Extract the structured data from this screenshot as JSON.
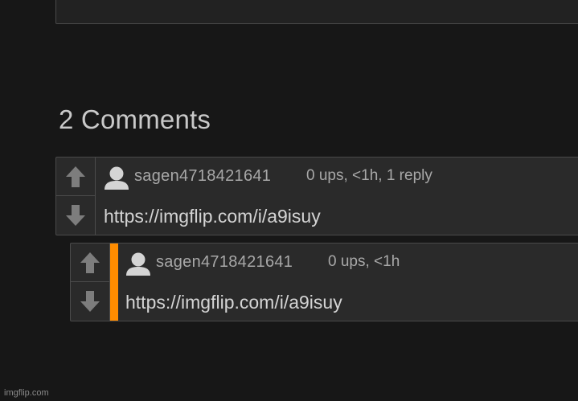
{
  "heading": "2 Comments",
  "comments": [
    {
      "username": "sagen4718421641",
      "meta": "0 ups, <1h, 1 reply",
      "text": "https://imgflip.com/i/a9isuy"
    },
    {
      "username": "sagen4718421641",
      "meta": "0 ups, <1h",
      "text": "https://imgflip.com/i/a9isuy"
    }
  ],
  "colors": {
    "background": "#171717",
    "panel": "#2a2a2a",
    "reply_accent": "#ff8c00"
  },
  "icons": [
    "upvote-arrow-icon",
    "downvote-arrow-icon",
    "user-avatar-icon"
  ],
  "watermark": "imgflip.com"
}
